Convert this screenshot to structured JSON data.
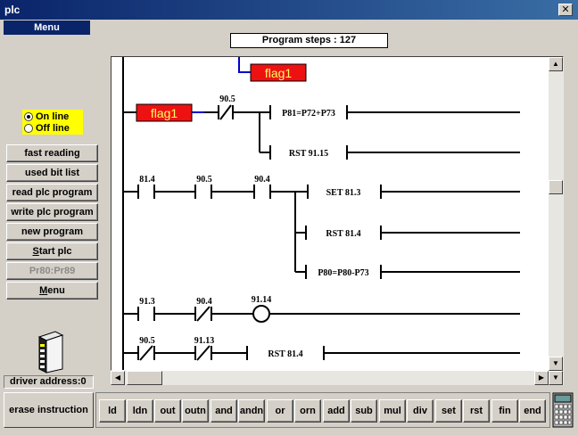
{
  "window": {
    "title": "plc",
    "close_glyph": "✕"
  },
  "menu": {
    "label": "Menu"
  },
  "status": {
    "program_steps": "Program steps : 127"
  },
  "mode": {
    "on_line": "On line",
    "off_line": "Off line",
    "selected": "On line"
  },
  "sidebar": {
    "buttons": [
      {
        "label": "fast reading",
        "enabled": true
      },
      {
        "label": "used bit list",
        "enabled": true
      },
      {
        "label": "read plc program",
        "enabled": true
      },
      {
        "label": "write plc program",
        "enabled": true
      },
      {
        "label": "new program",
        "enabled": true
      },
      {
        "label": "Start plc",
        "enabled": true,
        "underline": "S"
      },
      {
        "label": "Pr80:Pr89",
        "enabled": false
      },
      {
        "label": "Menu",
        "enabled": true,
        "underline": "M"
      }
    ],
    "driver_address": "driver address:0"
  },
  "ladder": {
    "flag_top": "flag1",
    "flag_left": "flag1",
    "r1_contact": "90.5",
    "r1_coil1": "P81=P72+P73",
    "r1_coil2": "RST 91.15",
    "r2_c1": "81.4",
    "r2_c2": "90.5",
    "r2_c3": "90.4",
    "r2_coil1": "SET 81.3",
    "r2_coil2": "RST 81.4",
    "r2_coil3": "P80=P80-P73",
    "r3_c1": "91.3",
    "r3_c2": "90.4",
    "r3_out": "91.14",
    "r4_c1": "90.5",
    "r4_c2": "91.13",
    "r4_coil": "RST 81.4",
    "flag_color": "#ee1111",
    "wire_color": "#000000",
    "link_color": "#0000cc"
  },
  "bottom": {
    "erase_label": "erase instruction",
    "instructions": [
      "ld",
      "ldn",
      "out",
      "outn",
      "and",
      "andn",
      "or",
      "orn",
      "add",
      "sub",
      "mul",
      "div",
      "set",
      "rst",
      "fin",
      "end"
    ]
  }
}
